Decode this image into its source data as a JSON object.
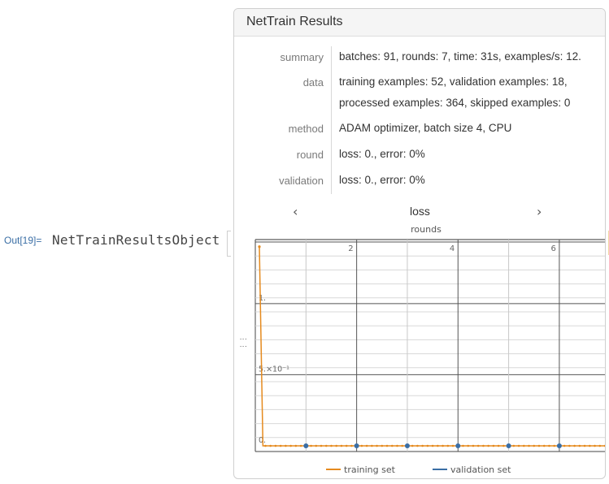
{
  "out_label": "Out[19]=",
  "out_head": "NetTrainResultsObject",
  "panel": {
    "title": "NetTrain Results",
    "rows": [
      {
        "label": "summary",
        "value": "batches: 91, rounds: 7, time: 31s, examples/s: 12."
      },
      {
        "label": "data",
        "value": "training examples: 52, validation examples: 18,",
        "value2": "processed examples: 364, skipped examples: 0"
      },
      {
        "label": "method",
        "value": "ADAM optimizer, batch size 4, CPU"
      },
      {
        "label": "round",
        "value": "loss: 0., error: 0%"
      },
      {
        "label": "validation",
        "value": "loss: 0., error: 0%"
      }
    ],
    "plot_selector": {
      "prev": "‹",
      "label": "loss",
      "next": "›"
    }
  },
  "chart_data": {
    "type": "line",
    "title": "loss",
    "xlabel": "rounds",
    "ylabel": "",
    "x_ticks": [
      "2",
      "4",
      "6"
    ],
    "y_ticks": [
      "0.",
      "5.×10⁻¹",
      "1."
    ],
    "xlim": [
      0,
      6.9
    ],
    "ylim": [
      -0.04,
      1.45
    ],
    "series": [
      {
        "name": "training set",
        "color": "#e58a1e",
        "x": [
          0.08,
          0.15,
          0.3,
          0.6,
          1.0,
          2.0,
          3.0,
          4.0,
          5.0,
          6.0,
          6.9
        ],
        "y": [
          1.4,
          0.0,
          0.0,
          0.0,
          0.0,
          0.0,
          0.0,
          0.0,
          0.0,
          0.0,
          0.0
        ]
      },
      {
        "name": "validation set",
        "color": "#3a6ea5",
        "x": [
          1,
          2,
          3,
          4,
          5,
          6
        ],
        "y": [
          0,
          0,
          0,
          0,
          0,
          0
        ]
      }
    ],
    "legend": "bottom",
    "grid": true
  }
}
